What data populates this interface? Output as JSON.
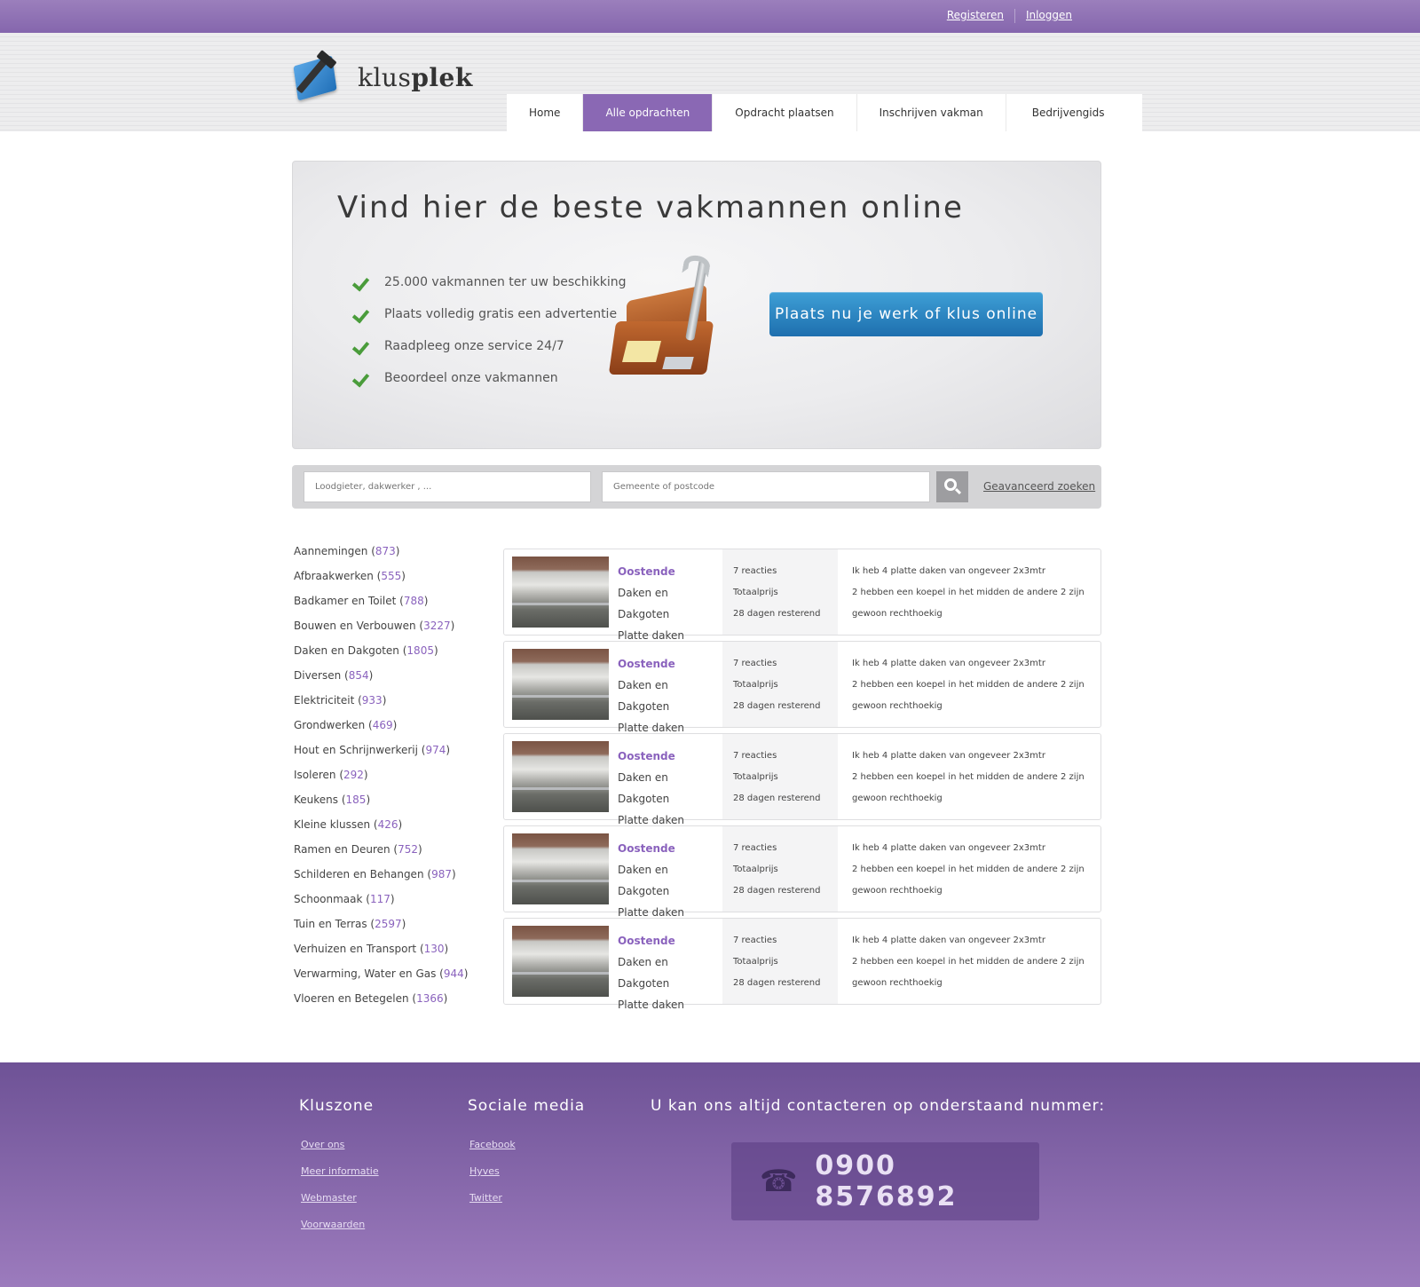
{
  "topbar": {
    "register": "Registeren",
    "login": "Inloggen"
  },
  "logo": {
    "part1": "klus",
    "part2": "plek"
  },
  "nav": [
    {
      "label": "Home",
      "active": false
    },
    {
      "label": "Alle opdrachten",
      "active": true
    },
    {
      "label": "Opdracht plaatsen",
      "active": false
    },
    {
      "label": "Inschrijven vakman",
      "active": false
    },
    {
      "label": "Bedrijvengids",
      "active": false
    }
  ],
  "hero": {
    "title": "Vind hier de beste vakmannen online",
    "benefits": [
      "25.000 vakmannen ter uw beschikking",
      "Plaats volledig gratis een advertentie",
      "Raadpleeg onze service 24/7",
      "Beoordeel onze vakmannen"
    ],
    "cta": "Plaats nu je werk of klus online"
  },
  "search": {
    "what_placeholder": "Loodgieter, dakwerker , ...",
    "where_placeholder": "Gemeente of postcode",
    "advanced": "Geavanceerd zoeken"
  },
  "categories": [
    {
      "name": "Aannemingen",
      "count": "873"
    },
    {
      "name": "Afbraakwerken",
      "count": "555"
    },
    {
      "name": "Badkamer en Toilet",
      "count": "788"
    },
    {
      "name": "Bouwen en Verbouwen",
      "count": "3227"
    },
    {
      "name": "Daken en Dakgoten",
      "count": "1805"
    },
    {
      "name": "Diversen",
      "count": "854"
    },
    {
      "name": "Elektriciteit",
      "count": "933"
    },
    {
      "name": "Grondwerken",
      "count": "469"
    },
    {
      "name": "Hout en Schrijnwerkerij",
      "count": "974"
    },
    {
      "name": "Isoleren",
      "count": "292"
    },
    {
      "name": "Keukens",
      "count": "185"
    },
    {
      "name": "Kleine klussen",
      "count": "426"
    },
    {
      "name": "Ramen en Deuren",
      "count": "752"
    },
    {
      "name": "Schilderen en Behangen",
      "count": "987"
    },
    {
      "name": "Schoonmaak",
      "count": "117"
    },
    {
      "name": "Tuin en Terras",
      "count": "2597"
    },
    {
      "name": "Verhuizen en Transport",
      "count": "130"
    },
    {
      "name": "Verwarming, Water en Gas",
      "count": "944"
    },
    {
      "name": "Vloeren en Betegelen",
      "count": "1366"
    }
  ],
  "listings": [
    {
      "city": "Oostende",
      "category": "Daken en Dakgoten",
      "sub": "Platte daken",
      "reactions": "7 reacties",
      "price": "Totaalprijs",
      "remaining": "28 dagen resterend",
      "desc1": "Ik heb 4 platte daken van ongeveer 2x3mtr",
      "desc2": "2 hebben een koepel in het midden de andere 2 zijn",
      "desc3": "gewoon rechthoekig"
    },
    {
      "city": "Oostende",
      "category": "Daken en Dakgoten",
      "sub": "Platte daken",
      "reactions": "7 reacties",
      "price": "Totaalprijs",
      "remaining": "28 dagen resterend",
      "desc1": "Ik heb 4 platte daken van ongeveer 2x3mtr",
      "desc2": "2 hebben een koepel in het midden de andere 2 zijn",
      "desc3": "gewoon rechthoekig"
    },
    {
      "city": "Oostende",
      "category": "Daken en Dakgoten",
      "sub": "Platte daken",
      "reactions": "7 reacties",
      "price": "Totaalprijs",
      "remaining": "28 dagen resterend",
      "desc1": "Ik heb 4 platte daken van ongeveer 2x3mtr",
      "desc2": "2 hebben een koepel in het midden de andere 2 zijn",
      "desc3": "gewoon rechthoekig"
    },
    {
      "city": "Oostende",
      "category": "Daken en Dakgoten",
      "sub": "Platte daken",
      "reactions": "7 reacties",
      "price": "Totaalprijs",
      "remaining": "28 dagen resterend",
      "desc1": "Ik heb 4 platte daken van ongeveer 2x3mtr",
      "desc2": "2 hebben een koepel in het midden de andere 2 zijn",
      "desc3": "gewoon rechthoekig"
    },
    {
      "city": "Oostende",
      "category": "Daken en Dakgoten",
      "sub": "Platte daken",
      "reactions": "7 reacties",
      "price": "Totaalprijs",
      "remaining": "28 dagen resterend",
      "desc1": "Ik heb 4 platte daken van ongeveer 2x3mtr",
      "desc2": "2 hebben een koepel in het midden de andere 2 zijn",
      "desc3": "gewoon rechthoekig"
    }
  ],
  "footer": {
    "col1_title": "Kluszone",
    "col1_links": [
      "Over ons",
      "Meer informatie",
      "Webmaster",
      "Voorwaarden"
    ],
    "col2_title": "Sociale media",
    "col2_links": [
      "Facebook",
      "Hyves",
      "Twitter"
    ],
    "contact_title": "U kan ons altijd contacteren op onderstaand nummer:",
    "phone_icon": "telephone-icon",
    "phone": "0900 8576892"
  },
  "colors": {
    "accent": "#8a68b4",
    "cta": "#2a84c3",
    "count": "#8a62bd"
  }
}
